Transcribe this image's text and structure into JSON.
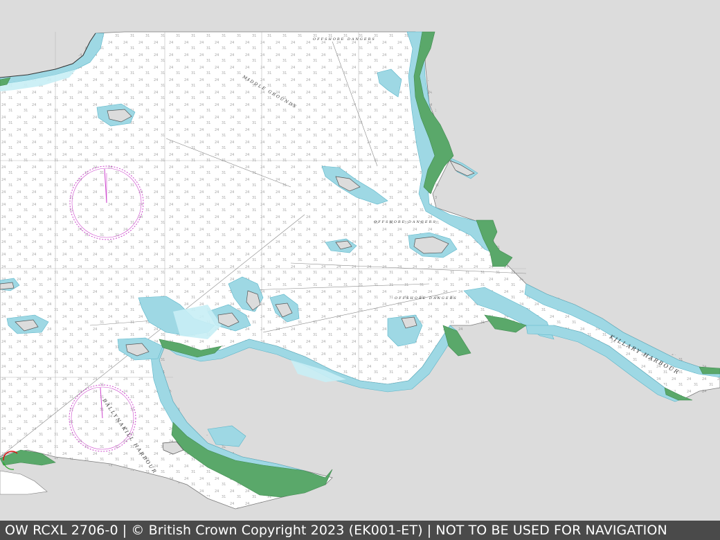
{
  "map": {
    "type": "nautical-chart",
    "place_labels": [
      {
        "text": "KILLARY HARBOUR"
      },
      {
        "text": "BALLYNAKILL HARBOUR"
      },
      {
        "text": "OFFSHORE DANGERS"
      },
      {
        "text": "OFFSHORE DANGERS"
      },
      {
        "text": "OFFSHORE DANGERS"
      },
      {
        "text": "MIDDLE GROUNDS"
      }
    ],
    "colors": {
      "background": "#dcdcdc",
      "land": "#dcdcdc",
      "sea": "#ffffff",
      "shallow_water": "#9ed8e4",
      "deep_shallow": "#c8eef5",
      "intertidal": "#5aa86a",
      "compass_rose": "#cc44cc",
      "footer_bg": "#4a4a4a",
      "footer_text": "#ffffff"
    }
  },
  "footer": {
    "text": "OW RCXL 2706-0 | © British Crown Copyright 2023 (EK001-ET) | NOT TO BE USED FOR NAVIGATION"
  }
}
